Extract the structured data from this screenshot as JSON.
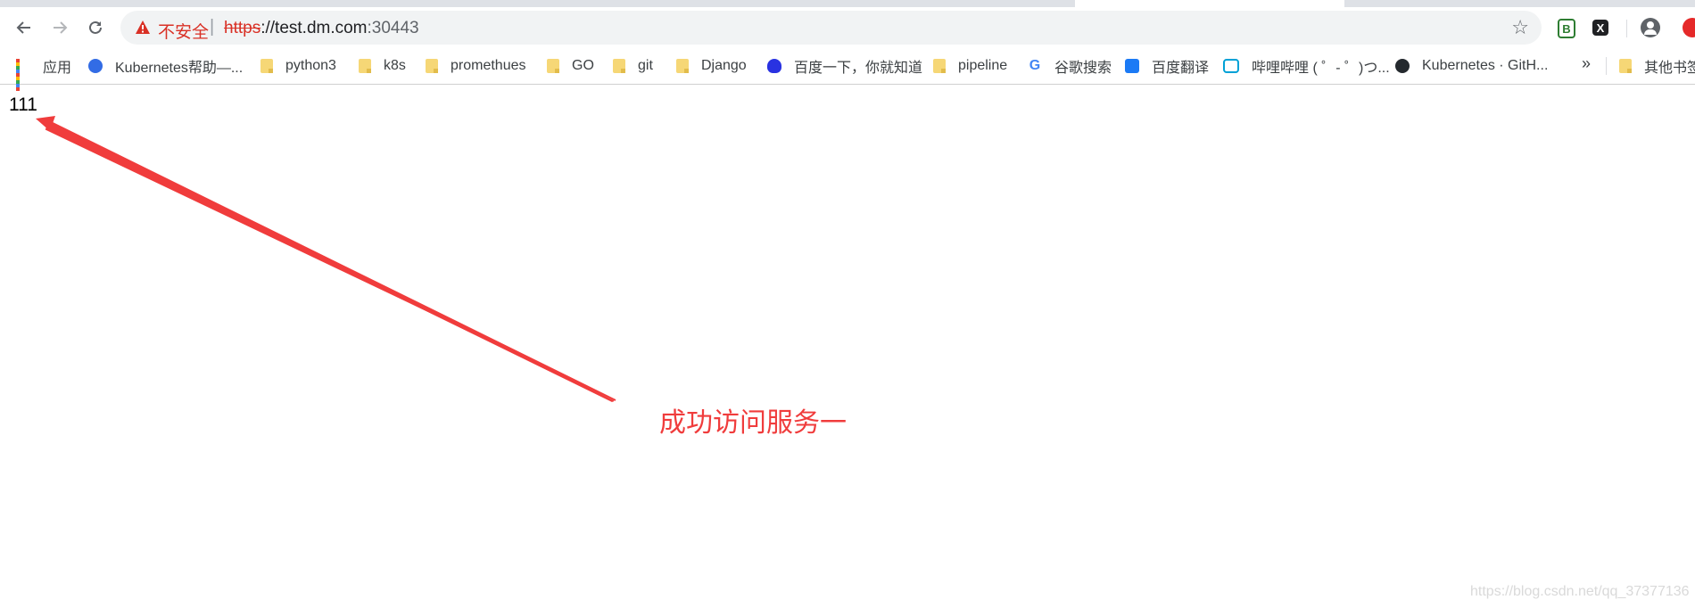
{
  "browser": {
    "security_label": "不安全",
    "separator": "|",
    "url_scheme": "https",
    "url_host": "://test.dm.com",
    "url_port": ":30443"
  },
  "bookmarks": [
    {
      "label": "应用",
      "icon": "apps-grid-icon"
    },
    {
      "label": "Kubernetes帮助—...",
      "icon": "kubernetes-icon"
    },
    {
      "label": "python3",
      "icon": "folder-icon"
    },
    {
      "label": "k8s",
      "icon": "folder-icon"
    },
    {
      "label": "promethues",
      "icon": "folder-icon"
    },
    {
      "label": "GO",
      "icon": "folder-icon"
    },
    {
      "label": "git",
      "icon": "folder-icon"
    },
    {
      "label": "Django",
      "icon": "folder-icon"
    },
    {
      "label": "百度一下，你就知道",
      "icon": "baidu-icon"
    },
    {
      "label": "pipeline",
      "icon": "folder-icon"
    },
    {
      "label": "谷歌搜索",
      "icon": "google-icon"
    },
    {
      "label": "百度翻译",
      "icon": "baidu-translate-icon"
    },
    {
      "label": "哔哩哔哩 ( ゜- ゜)つ...",
      "icon": "bilibili-icon"
    },
    {
      "label": "Kubernetes · GitH...",
      "icon": "github-icon"
    }
  ],
  "bookmarks_more": "»",
  "other_bookmarks": "其他书签",
  "page": {
    "body_text": "111"
  },
  "annotation": {
    "text": "成功访问服务一",
    "color": "#f03c3c"
  },
  "watermark": "https://blog.csdn.net/qq_37377136",
  "colors": {
    "insecure": "#d93025",
    "toolbar_icon": "#5f6368"
  }
}
